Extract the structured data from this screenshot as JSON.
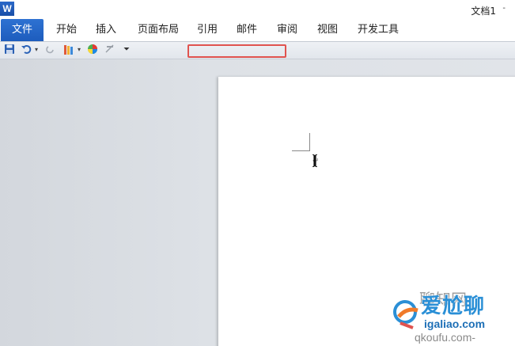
{
  "app": {
    "icon_letter": "W",
    "document_title": "文档1",
    "title_menu_caret": "-"
  },
  "ribbon": {
    "tabs": [
      {
        "label": "文件",
        "active": true
      },
      {
        "label": "开始"
      },
      {
        "label": "插入"
      },
      {
        "label": "页面布局"
      },
      {
        "label": "引用"
      },
      {
        "label": "邮件"
      },
      {
        "label": "审阅"
      },
      {
        "label": "视图"
      },
      {
        "label": "开发工具"
      }
    ]
  },
  "quick_access": {
    "items": [
      {
        "icon": "save-icon"
      },
      {
        "icon": "undo-icon"
      },
      {
        "icon": "dropdown-arrow-icon"
      },
      {
        "icon": "redo-icon"
      },
      {
        "icon": "format-painter-icon"
      },
      {
        "icon": "dropdown-arrow-icon"
      },
      {
        "icon": "color-wheel-icon"
      },
      {
        "icon": "clear-format-icon"
      },
      {
        "icon": "customize-toolbar-icon"
      }
    ],
    "highlight_color": "#e0534f"
  },
  "document": {
    "paragraph_mark": "↵"
  },
  "watermark": {
    "faded_text": "聊知网",
    "main_text": "爱尬聊",
    "url": "igaliao.com",
    "url_faded": "qkoufu.com-"
  },
  "colors": {
    "file_tab": "#1d5cbd",
    "highlight": "#e0534f",
    "watermark_blue": "#2a8fd6"
  }
}
